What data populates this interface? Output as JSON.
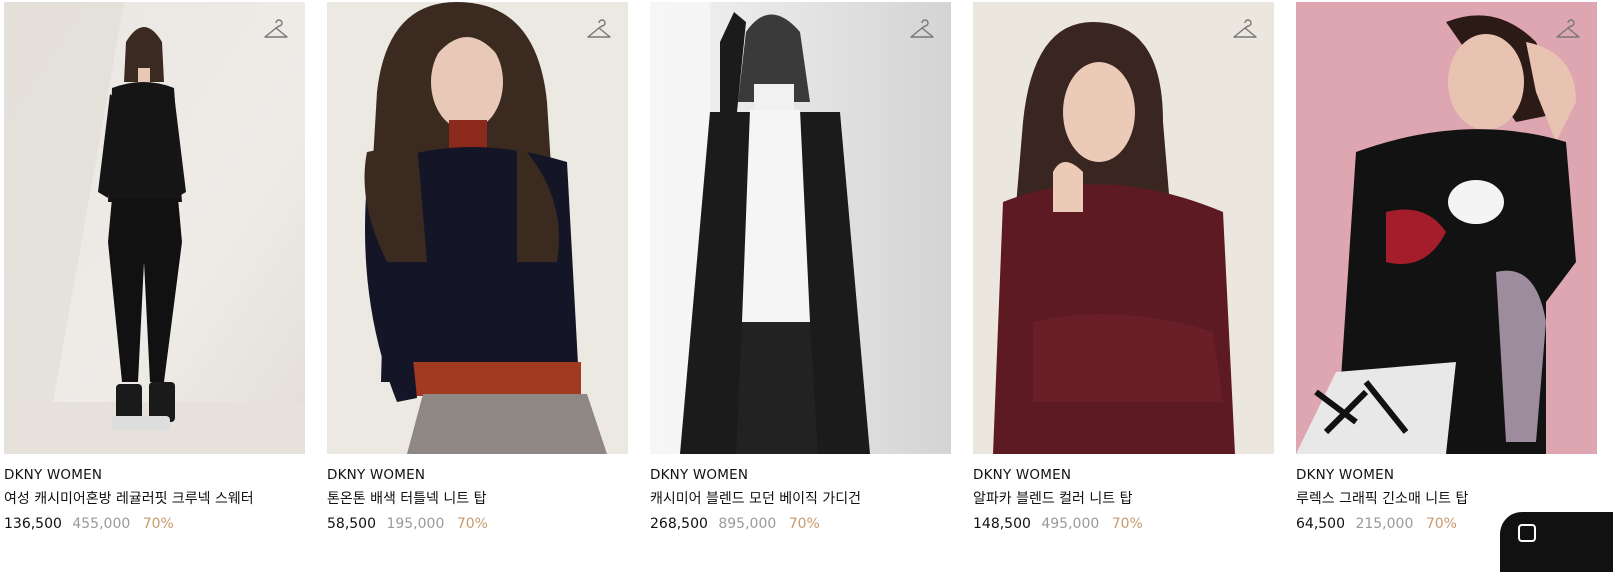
{
  "products": [
    {
      "brand": "DKNY WOMEN",
      "name": "여성 캐시미어혼방 레귤러핏 크루넥 스웨터",
      "price": "136,500",
      "original_price": "455,000",
      "discount": "70%",
      "icon": "hanger-icon"
    },
    {
      "brand": "DKNY WOMEN",
      "name": "톤온톤 배색 터틀넥 니트 탑",
      "price": "58,500",
      "original_price": "195,000",
      "discount": "70%",
      "icon": "hanger-icon"
    },
    {
      "brand": "DKNY WOMEN",
      "name": "캐시미어 블렌드 모던 베이직 가디건",
      "price": "268,500",
      "original_price": "895,000",
      "discount": "70%",
      "icon": "hanger-icon"
    },
    {
      "brand": "DKNY WOMEN",
      "name": "알파카 블렌드 컬러 니트 탑",
      "price": "148,500",
      "original_price": "495,000",
      "discount": "70%",
      "icon": "hanger-icon"
    },
    {
      "brand": "DKNY WOMEN",
      "name": "루렉스 그래픽 긴소매 니트 탑",
      "price": "64,500",
      "original_price": "215,000",
      "discount": "70%",
      "icon": "hanger-icon"
    }
  ],
  "colors": {
    "discount": "#c9996b",
    "original_price": "#9a9a9a",
    "text": "#111111"
  }
}
